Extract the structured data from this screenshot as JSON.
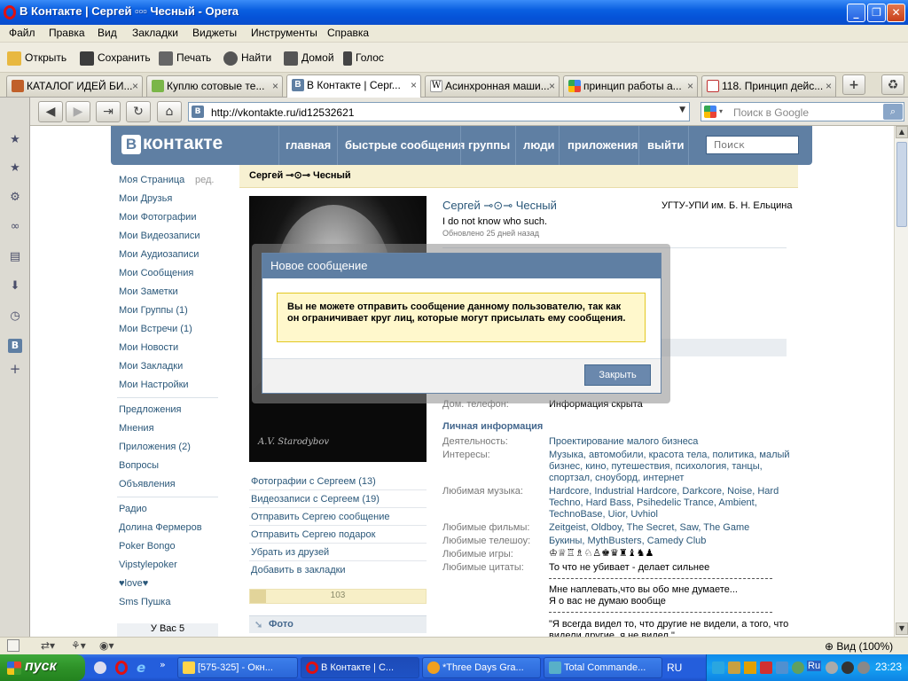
{
  "window": {
    "title": "В Контакте | Сергей ▫▫▫ Чесный - Opera"
  },
  "menu": [
    "Файл",
    "Правка",
    "Вид",
    "Закладки",
    "Виджеты",
    "Инструменты",
    "Справка"
  ],
  "toolbar": {
    "open": "Открыть",
    "save": "Сохранить",
    "print": "Печать",
    "find": "Найти",
    "home": "Домой",
    "voice": "Голос"
  },
  "tabs": [
    {
      "label": "КАТАЛОГ ИДЕЙ БИ...",
      "close": "×"
    },
    {
      "label": "Куплю сотовые те...",
      "close": "×"
    },
    {
      "label": "В Контакте | Серг...",
      "close": "×"
    },
    {
      "label": "Асинхронная маши...",
      "close": "×"
    },
    {
      "label": "принцип работы а...",
      "close": "×"
    },
    {
      "label": "118. Принцип дейс...",
      "close": "×"
    }
  ],
  "address": {
    "url": "http://vkontakte.ru/id12532621",
    "search_placeholder": "Поиск в Google"
  },
  "vk": {
    "logo": "контакте",
    "nav": [
      "главная",
      "быстрые сообщения",
      "группы",
      "люди",
      "приложения",
      "выйти"
    ],
    "search_placeholder": "Поиск",
    "left": {
      "edit": "ред.",
      "main": [
        "Моя Страница",
        "Мои Друзья",
        "Мои Фотографии",
        "Мои Видеозаписи",
        "Мои Аудиозаписи",
        "Мои Сообщения",
        "Мои Заметки",
        "Мои Группы (1)",
        "Мои Встречи (1)",
        "Мои Новости",
        "Мои Закладки",
        "Мои Настройки"
      ],
      "secondary": [
        "Предложения",
        "Мнения",
        "Приложения (2)",
        "Вопросы",
        "Объявления"
      ],
      "apps": [
        "Радио",
        "Долина Фермеров",
        "Poker Bongo",
        "Vipstylepoker",
        "♥love♥",
        "Sms Пушка"
      ],
      "bottom": "У Вас 5"
    },
    "profile": {
      "header": "Сергей ⊸⊙⊸ Чесный",
      "name": "Сергей ⊸⊙⊸ Чесный",
      "status": "I do not know who such.",
      "updated": "Обновлено 25 дней назад",
      "university": "УГТУ-УПИ им. Б. Н. Ельцина",
      "photo_sig": "A.V. Starodybov",
      "links": [
        "Фотографии с Сергеем (13)",
        "Видеозаписи с Сергеем (19)",
        "Отправить Сергею сообщение",
        "Отправить Сергею подарок",
        "Убрать из друзей",
        "Добавить в закладки"
      ],
      "rating": "103",
      "photo_section": "Фото",
      "phone_label": "Дом. телефон:",
      "phone_value": "Информация скрыта",
      "personal_title": "Личная информация",
      "rows": [
        {
          "label": "Деятельность:",
          "value": "Проектирование малого бизнеса"
        },
        {
          "label": "Интересы:",
          "value": "Музыка, автомобили, красота тела, политика, малый бизнес, кино, путешествия, психология, танцы, спортзал, сноуборд, интернет"
        },
        {
          "label": "Любимая музыка:",
          "value": "Hardcore, Industrial Hardcore, Darkcore, Noise, Hard Techno, Hard Bass, Psihedelic Trance, Ambient, TechnoBase, Uior, Uvhiol"
        },
        {
          "label": "Любимые фильмы:",
          "value": "Zeitgeist, Oldboy, The Secret, Saw, The Game"
        },
        {
          "label": "Любимые телешоу:",
          "value": "Букины, MythBusters, Camedy Club"
        },
        {
          "label": "Любимые игры:",
          "value": "♔♕♖♗♘♙♚♛♜♝♞♟"
        },
        {
          "label": "Любимые цитаты:",
          "value": "То что не убивает - делает сильнее"
        }
      ],
      "quotes": [
        "Мне наплевать,что вы обо мне думаете...",
        "Я о вас не думаю вообще",
        "\"Я всегда видел то, что другие не видели, а того, что видели другие, я не видел.\""
      ]
    },
    "dialog": {
      "title": "Новое сообщение",
      "message": "Вы не можете отправить сообщение данному пользователю, так как он ограничивает круг лиц, которые могут присылать ему сообщения.",
      "close": "Закрыть"
    }
  },
  "status": {
    "zoom": "Вид (100%)"
  },
  "taskbar": {
    "start": "пуск",
    "items": [
      "[575-325] - Окн...",
      "В Контакте | С...",
      "*Three Days Gra...",
      "Total Commande..."
    ],
    "lang": "RU",
    "tray_lang": "Ru",
    "clock": "23:23"
  }
}
